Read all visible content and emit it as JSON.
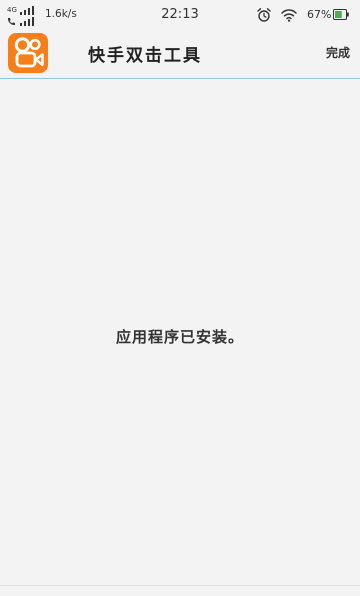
{
  "status_bar": {
    "network_type": "4G",
    "net_speed": "1.6k/s",
    "time": "22:13",
    "battery_percent": "67%",
    "icons": [
      "signal-icon",
      "call-signal-icon",
      "alarm-icon",
      "wifi-icon",
      "battery-icon"
    ],
    "battery_level": 0.67,
    "battery_color": "#4caf50"
  },
  "app_bar": {
    "title": "快手双击工具",
    "done_label": "完成",
    "logo_icon": "kuaishou-logo-icon",
    "logo_color": "#f77f1a",
    "divider_color": "#8fc7e6"
  },
  "main": {
    "message": "应用程序已安装。"
  }
}
